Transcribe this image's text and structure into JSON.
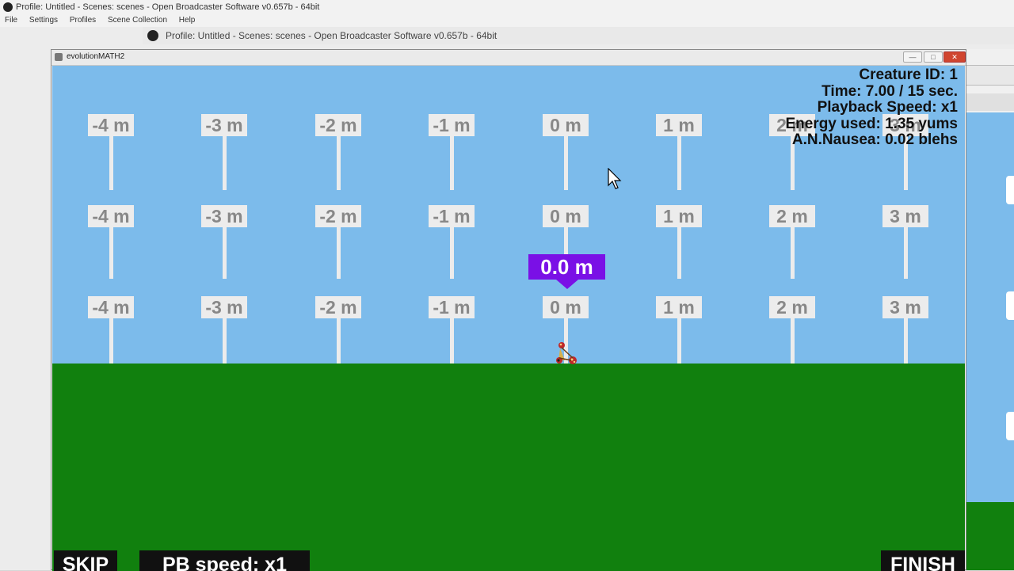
{
  "obs_back": {
    "title": "Profile: Untitled - Scenes: scenes - Open Broadcaster Software v0.657b - 64bit",
    "menu": [
      "File",
      "Settings",
      "Profiles",
      "Scene Collection",
      "Help"
    ]
  },
  "obs_front": {
    "title": "Profile: Untitled - Scenes: scenes - Open Broadcaster Software v0.657b - 64bit"
  },
  "game_window": {
    "title": "evolutionMATH2",
    "controls": {
      "minimize": "—",
      "maximize": "□",
      "close": "✕"
    }
  },
  "signs": {
    "rows": [
      [
        "-4 m",
        "-3 m",
        "-2 m",
        "-1 m",
        "0 m",
        "1 m",
        "2 m",
        "3 m"
      ],
      [
        "-4 m",
        "-3 m",
        "-2 m",
        "-1 m",
        "0 m",
        "1 m",
        "2 m",
        "3 m"
      ],
      [
        "-4 m",
        "-3 m",
        "-2 m",
        "-1 m",
        "0 m",
        "1 m",
        "2 m",
        "3 m"
      ]
    ]
  },
  "distance_marker": {
    "label": "0.0 m"
  },
  "hud": {
    "creature_id": "Creature ID: 1",
    "time": "Time: 7.00 / 15 sec.",
    "playback_speed": "Playback Speed: x1",
    "energy": "Energy used: 1.35 yums",
    "nausea": "A.N.Nausea: 0.02 blehs"
  },
  "buttons": {
    "skip": "SKIP",
    "pb_speed": "PB speed: x1",
    "finish": "FINISH"
  },
  "colors": {
    "sky": "#7cbbeb",
    "grass": "#11800e",
    "marker": "#7a10e6",
    "sign": "#ececec",
    "sign_text": "#888888"
  },
  "icons": {
    "obs": "obs-logo-icon",
    "cursor": "mouse-pointer-icon",
    "creature": "creature-sprite"
  }
}
